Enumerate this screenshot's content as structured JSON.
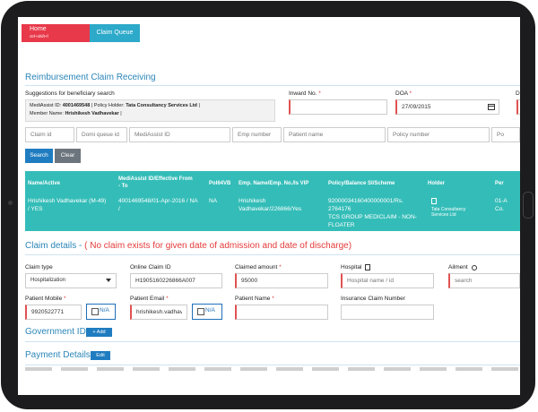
{
  "tabs": {
    "home_label": "Home",
    "home_shortcut": "ctrl+shift+f",
    "claim_queue_label": "Claim Queue"
  },
  "page_title": "Reimbursement Claim Receiving",
  "suggestions": {
    "label": "Suggestions for beneficiary search",
    "mediassist_label": "MediAssist ID:",
    "mediassist_value": "4001469548",
    "policy_holder_label": "| Policy Holder:",
    "policy_holder_value": "Tata Consultancy Services Ltd",
    "member_label": "Member Name:",
    "member_value": "Hrishikesh Vadhavekar",
    "sep": "|"
  },
  "inward": {
    "label": "Inward No.",
    "required_mark": "*",
    "value": ""
  },
  "doa": {
    "label": "DOA",
    "required_mark": "*",
    "value": "27/09/2015"
  },
  "cut_label": "D",
  "search_fields": {
    "claim_id": "Claim id",
    "domi_queue_id": "Domi queue id",
    "mediassist_id": "MediAssist ID",
    "emp_number": "Emp number",
    "patient_name": "Patient name",
    "policy_number": "Policy number",
    "policy_cut": "Po"
  },
  "buttons": {
    "search": "Search",
    "clear": "Clear"
  },
  "grid": {
    "headers": {
      "name": "Name/Active",
      "mediassist_line1": "MediAssist ID/Effective From",
      "mediassist_line2": "- To",
      "pol64vb": "Pol64VB",
      "emp_name": "Emp. Name/Emp. No./Is VIP",
      "policy": "Policy/Balance SI/Scheme",
      "holder": "Holder",
      "per": "Per"
    },
    "row": {
      "name_line1": "Hrishikesh Vadhavekar (M-49)",
      "name_line2": "/ YES",
      "mediassist": "4001469548/01-Apr-2016 / NA",
      "mediassist_line2": "/",
      "pol64vb": "NA",
      "emp_line1": "Hrishikesh",
      "emp_line2": "Vadhavekar/226866/Yes",
      "policy_line1": "92000034160400000001/Rs.",
      "policy_line2": "2764176",
      "policy_line3": "TCS GROUP MEDICLAIM - NON-",
      "policy_line4": "FLOATER",
      "holder_icon": "building-icon",
      "holder_line1": "Tata Consultancy",
      "holder_line2": "Services Ltd",
      "per_line1": "01-A",
      "per_line2": "Co."
    }
  },
  "claim_details": {
    "title": "Claim details - ",
    "warning": "( No claim exists for given date of admission and date of discharge)"
  },
  "form": {
    "claim_type": {
      "label": "Claim type",
      "value": "Hospitalization"
    },
    "online_claim_id": {
      "label": "Online Claim ID",
      "value": "H1905160226866A007"
    },
    "claimed_amount": {
      "label": "Claimed amount",
      "required_mark": "*",
      "value": "95000"
    },
    "hospital": {
      "label": "Hospital",
      "placeholder": "Hospital name / id"
    },
    "ailment": {
      "label": "Ailment",
      "placeholder": "search"
    },
    "patient_mobile": {
      "label": "Patient Mobile",
      "required_mark": "*",
      "value": "9920522771"
    },
    "patient_email": {
      "label": "Patient Email",
      "required_mark": "*",
      "value": "hrishikesh.vadhavel"
    },
    "patient_name": {
      "label": "Patient Name",
      "required_mark": "*",
      "value": ""
    },
    "insurance_claim_number": {
      "label": "Insurance Claim Number",
      "value": ""
    },
    "na_label": "N/A"
  },
  "government_id": {
    "title": "Government ID",
    "add_label": "+ Add"
  },
  "payment_details": {
    "title": "Payment Details",
    "edit_label": "Edit"
  },
  "colors": {
    "accent": "#2b86b8",
    "home_tab": "#e8394a",
    "queue_tab": "#2da9c9",
    "grid": "#34bdb8",
    "warning": "#e53a3a"
  }
}
